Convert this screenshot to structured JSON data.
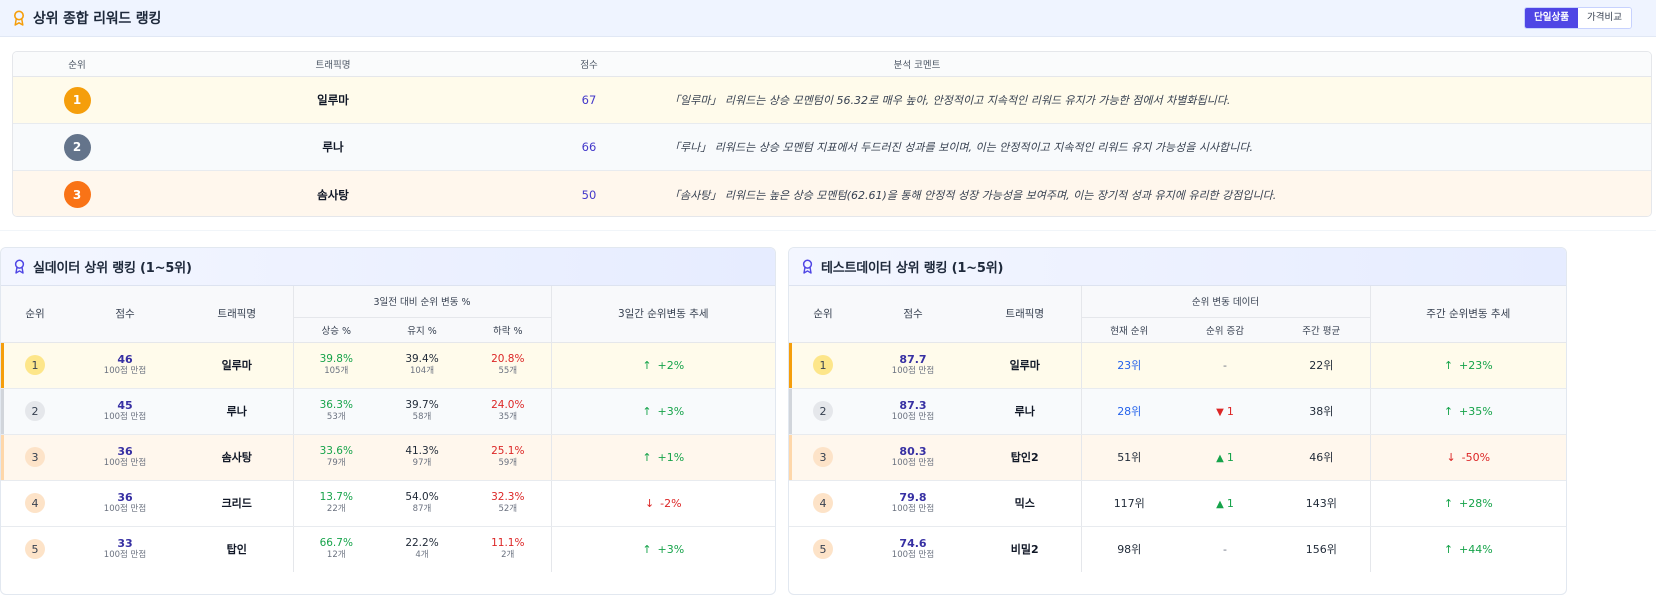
{
  "top": {
    "title": "상위 종합 리워드 랭킹",
    "toggle": [
      "단일상품",
      "가격비교"
    ],
    "columns": {
      "rank": "순위",
      "name": "트래픽명",
      "score": "점수",
      "comment": "분석 코멘트"
    },
    "rows": [
      {
        "rank": "1",
        "name": "일루마",
        "score": "67",
        "comment": "「일루마」 리워드는 상승 모멘텀이 56.32로 매우 높아, 안정적이고 지속적인 리워드 유지가 가능한 점에서 차별화됩니다."
      },
      {
        "rank": "2",
        "name": "루나",
        "score": "66",
        "comment": "「루나」 리워드는 상승 모멘텀 지표에서 두드러진 성과를 보이며, 이는 안정적이고 지속적인 리워드 유지 가능성을 시사합니다."
      },
      {
        "rank": "3",
        "name": "솜사탕",
        "score": "50",
        "comment": "「솜사탕」 리워드는 높은 상승 모멘텀(62.61)을 통해 안정적 성장 가능성을 보여주며, 이는 장기적 성과 유지에 유리한 강점입니다."
      }
    ],
    "medal_colors": [
      "#f59e0b",
      "#64748b",
      "#f97316"
    ]
  },
  "real": {
    "title": "실데이터 상위 랭킹 (1~5위)",
    "headers": {
      "rank": "순위",
      "score": "점수",
      "name": "트래픽명",
      "group": "3일전 대비 순위 변동 %",
      "up": "상승 %",
      "keep": "유지 %",
      "down": "하락 %",
      "trend": "3일간 순위변동 추세"
    },
    "rows": [
      {
        "rank": "1",
        "score": "46",
        "score_sub": "100점 만점",
        "name": "일루마",
        "up": "39.8%",
        "up_cnt": "105개",
        "keep": "39.4%",
        "keep_cnt": "104개",
        "down": "20.8%",
        "down_cnt": "55개",
        "trend_arrow": "↑",
        "trend": "+2%"
      },
      {
        "rank": "2",
        "score": "45",
        "score_sub": "100점 만점",
        "name": "루나",
        "up": "36.3%",
        "up_cnt": "53개",
        "keep": "39.7%",
        "keep_cnt": "58개",
        "down": "24.0%",
        "down_cnt": "35개",
        "trend_arrow": "↑",
        "trend": "+3%"
      },
      {
        "rank": "3",
        "score": "36",
        "score_sub": "100점 만점",
        "name": "솜사탕",
        "up": "33.6%",
        "up_cnt": "79개",
        "keep": "41.3%",
        "keep_cnt": "97개",
        "down": "25.1%",
        "down_cnt": "59개",
        "trend_arrow": "↑",
        "trend": "+1%"
      },
      {
        "rank": "4",
        "score": "36",
        "score_sub": "100점 만점",
        "name": "크리드",
        "up": "13.7%",
        "up_cnt": "22개",
        "keep": "54.0%",
        "keep_cnt": "87개",
        "down": "32.3%",
        "down_cnt": "52개",
        "trend_arrow": "↓",
        "trend": "-2%"
      },
      {
        "rank": "5",
        "score": "33",
        "score_sub": "100점 만점",
        "name": "탑인",
        "up": "66.7%",
        "up_cnt": "12개",
        "keep": "22.2%",
        "keep_cnt": "4개",
        "down": "11.1%",
        "down_cnt": "2개",
        "trend_arrow": "↑",
        "trend": "+3%"
      }
    ]
  },
  "test": {
    "title": "테스트데이터 상위 랭킹 (1~5위)",
    "headers": {
      "rank": "순위",
      "score": "점수",
      "name": "트래픽명",
      "group": "순위 변동 데이터",
      "current": "현재 순위",
      "change": "순위 증감",
      "weekly": "주간 평균",
      "trend": "주간 순위변동 추세"
    },
    "rows": [
      {
        "rank": "1",
        "score": "87.7",
        "score_sub": "100점 만점",
        "name": "일루마",
        "current": "23위",
        "change_arrow": "",
        "change": "-",
        "weekly": "22위",
        "trend_arrow": "↑",
        "trend": "+23%"
      },
      {
        "rank": "2",
        "score": "87.3",
        "score_sub": "100점 만점",
        "name": "루나",
        "current": "28위",
        "change_arrow": "▼",
        "change": "1",
        "weekly": "38위",
        "trend_arrow": "↑",
        "trend": "+35%"
      },
      {
        "rank": "3",
        "score": "80.3",
        "score_sub": "100점 만점",
        "name": "탑인2",
        "current": "51위",
        "change_arrow": "▲",
        "change": "1",
        "weekly": "46위",
        "trend_arrow": "↓",
        "trend": "-50%"
      },
      {
        "rank": "4",
        "score": "79.8",
        "score_sub": "100점 만점",
        "name": "믹스",
        "current": "117위",
        "change_arrow": "▲",
        "change": "1",
        "weekly": "143위",
        "trend_arrow": "↑",
        "trend": "+28%"
      },
      {
        "rank": "5",
        "score": "74.6",
        "score_sub": "100점 만점",
        "name": "비밀2",
        "current": "98위",
        "change_arrow": "",
        "change": "-",
        "weekly": "156위",
        "trend_arrow": "↑",
        "trend": "+44%"
      }
    ]
  }
}
